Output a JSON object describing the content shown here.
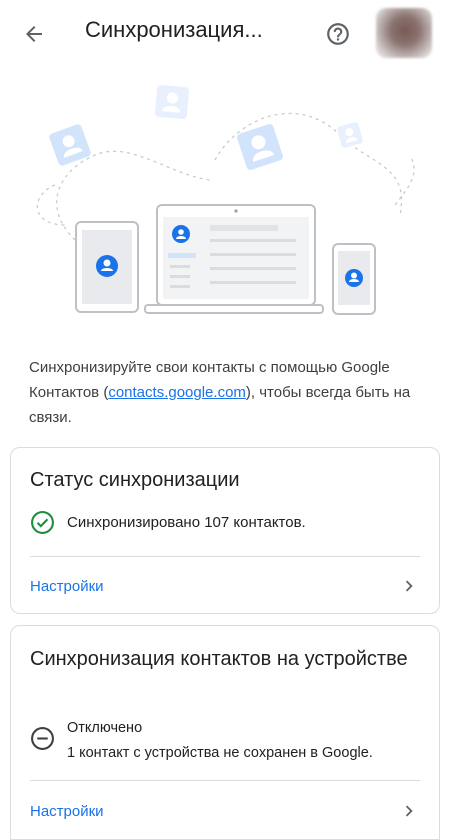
{
  "header": {
    "title": "Синхронизация...",
    "back_icon": "arrow-back-icon",
    "help_icon": "help-circle-icon"
  },
  "intro": {
    "text_before": "Синхронизируйте свои контакты с помощью Google Контактов (",
    "link": "contacts.google.com",
    "text_after": "), чтобы всегда быть на связи."
  },
  "sync_status_card": {
    "title": "Статус синхронизации",
    "status_text": "Синхронизировано 107 контактов.",
    "status_icon": "check-circle-icon",
    "settings_label": "Настройки"
  },
  "device_sync_card": {
    "title": "Синхронизация контактов на устройстве",
    "status_label": "Отключено",
    "status_detail": "1 контакт с устройства не сохранен в Google.",
    "status_icon": "minus-circle-icon",
    "settings_label": "Настройки"
  },
  "colors": {
    "accent": "#1a73e8",
    "success": "#1e8e3e",
    "text": "#202124",
    "divider": "#dadce0"
  }
}
